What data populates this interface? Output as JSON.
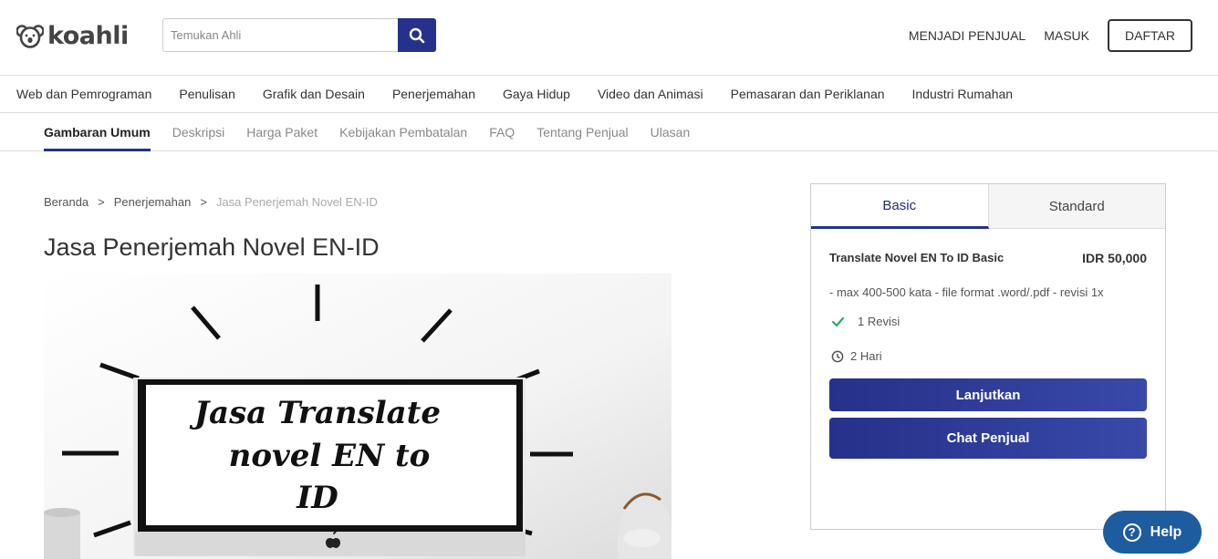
{
  "brand": {
    "name": "koahli"
  },
  "search": {
    "placeholder": "Temukan Ahli"
  },
  "header_nav": {
    "sell": "MENJADI PENJUAL",
    "login": "MASUK",
    "register": "DAFTAR"
  },
  "categories": [
    "Web dan Pemrograman",
    "Penulisan",
    "Grafik dan Desain",
    "Penerjemahan",
    "Gaya Hidup",
    "Video dan Animasi",
    "Pemasaran dan Periklanan",
    "Industri Rumahan"
  ],
  "section_tabs": [
    "Gambaran Umum",
    "Deskripsi",
    "Harga Paket",
    "Kebijakan Pembatalan",
    "FAQ",
    "Tentang Penjual",
    "Ulasan"
  ],
  "breadcrumb": {
    "home": "Beranda",
    "category": "Penerjemahan",
    "current": "Jasa Penerjemah Novel EN-ID"
  },
  "page_title": "Jasa Penerjemah Novel EN-ID",
  "hero": {
    "line1": "Jasa Translate",
    "line2": "novel EN to",
    "line3": "ID"
  },
  "package": {
    "tabs": [
      "Basic",
      "Standard"
    ],
    "name": "Translate Novel EN To ID Basic",
    "price": "IDR 50,000",
    "description": "- max 400-500 kata - file format .word/.pdf - revisi 1x",
    "revisions": "1 Revisi",
    "delivery": "2 Hari",
    "continue_label": "Lanjutkan",
    "chat_label": "Chat Penjual"
  },
  "help": {
    "label": "Help"
  },
  "colors": {
    "primary": "#25318a",
    "help": "#1d5c9e",
    "check": "#2eaa5c"
  }
}
